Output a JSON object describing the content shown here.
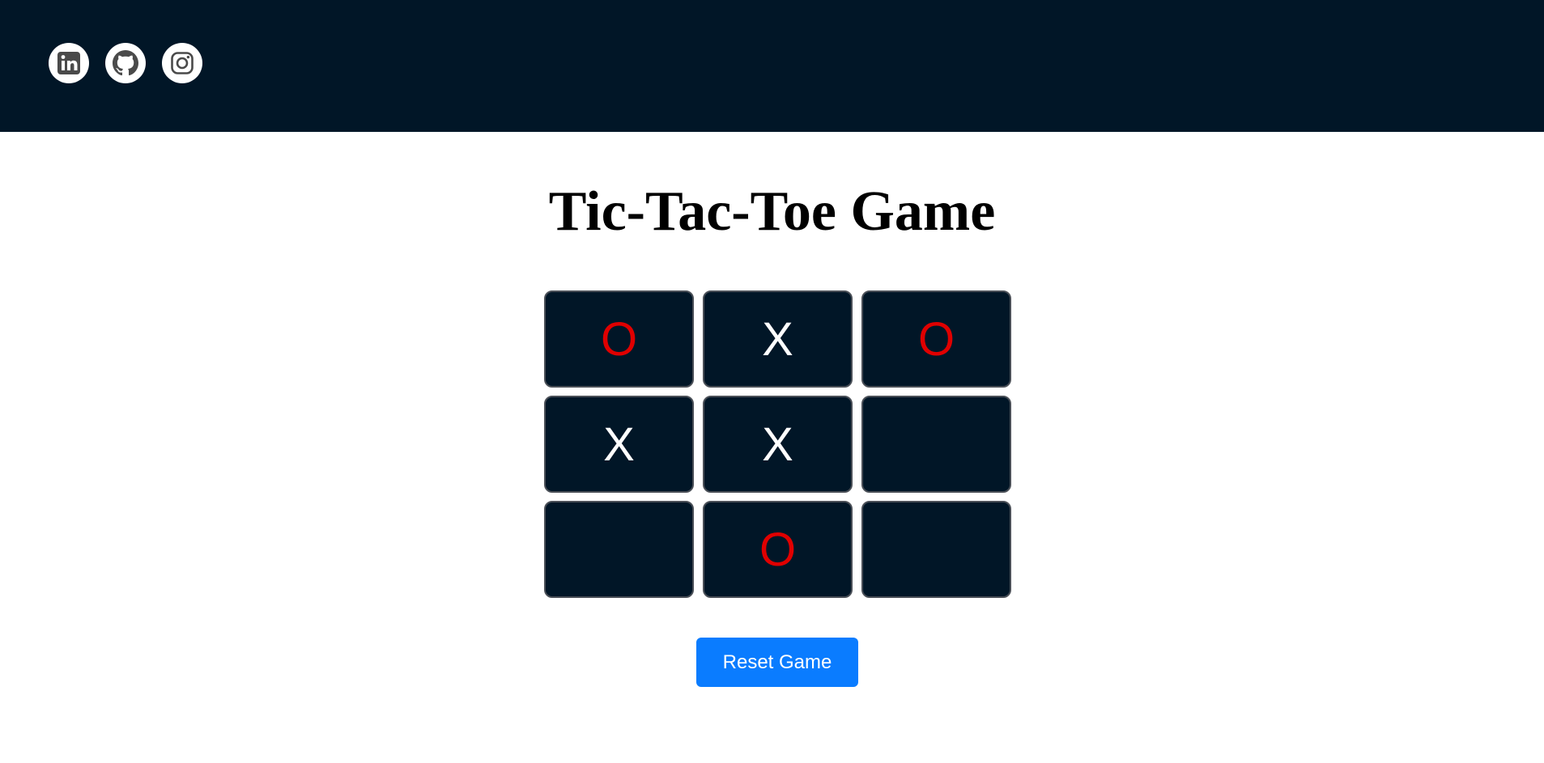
{
  "header": {
    "social_links": [
      {
        "name": "linkedin",
        "icon": "linkedin-icon"
      },
      {
        "name": "github",
        "icon": "github-icon"
      },
      {
        "name": "instagram",
        "icon": "instagram-icon"
      }
    ],
    "background_color": "#011627"
  },
  "game": {
    "title": "Tic-Tac-Toe Game",
    "board": [
      "O",
      "X",
      "O",
      "X",
      "X",
      "",
      "",
      "O",
      ""
    ],
    "colors": {
      "cell_background": "#011627",
      "x_mark": "#ffffff",
      "o_mark": "#e00000"
    },
    "reset_label": "Reset Game",
    "reset_color": "#0a7cff"
  }
}
